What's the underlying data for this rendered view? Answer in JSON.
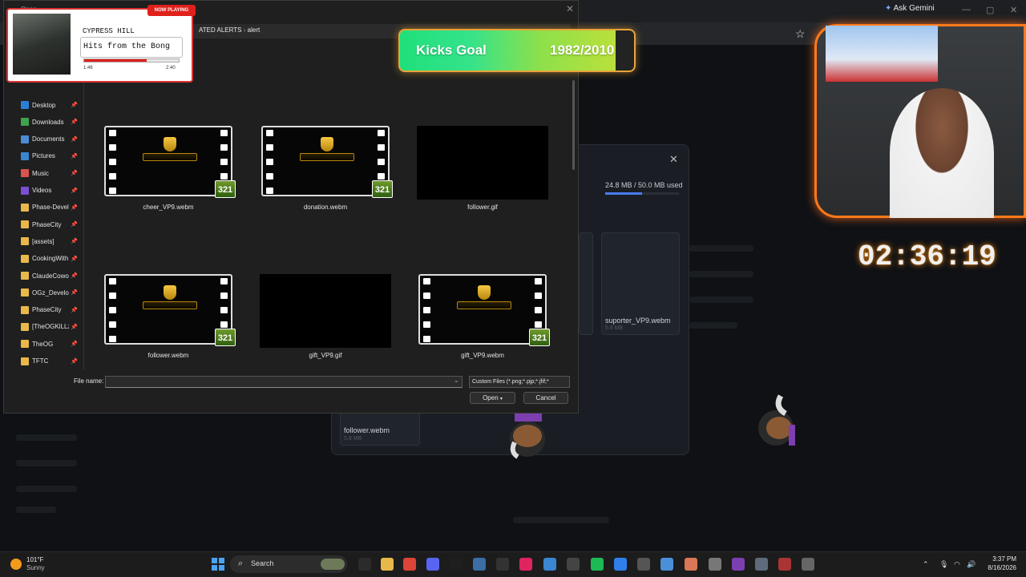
{
  "browser": {
    "ask_gemini": "Ask Gemini"
  },
  "dialog": {
    "title_partial": "Open",
    "breadcrumb": [
      "ATED ALERTS",
      "alert"
    ],
    "nav_items": [
      {
        "label": "Desktop",
        "icon": "desktop-icon",
        "color": "#2b7fd4"
      },
      {
        "label": "Downloads",
        "icon": "download-icon",
        "color": "#3fa34d"
      },
      {
        "label": "Documents",
        "icon": "documents-icon",
        "color": "#4c8bd6"
      },
      {
        "label": "Pictures",
        "icon": "pictures-icon",
        "color": "#3a86d1"
      },
      {
        "label": "Music",
        "icon": "music-icon",
        "color": "#d9534f"
      },
      {
        "label": "Videos",
        "icon": "videos-icon",
        "color": "#7a4fd1"
      },
      {
        "label": "Phase-Develc",
        "icon": "folder-icon",
        "color": "#e8b84a"
      },
      {
        "label": "PhaseCity",
        "icon": "folder-icon",
        "color": "#e8b84a"
      },
      {
        "label": "[assets]",
        "icon": "folder-icon",
        "color": "#e8b84a"
      },
      {
        "label": "CookingWith",
        "icon": "folder-icon",
        "color": "#e8b84a"
      },
      {
        "label": "ClaudeCowo",
        "icon": "folder-icon",
        "color": "#e8b84a"
      },
      {
        "label": "OGz_Develop",
        "icon": "folder-icon",
        "color": "#e8b84a"
      },
      {
        "label": "PhaseCity",
        "icon": "folder-icon",
        "color": "#e8b84a"
      },
      {
        "label": "[TheOGKiLLz",
        "icon": "folder-icon",
        "color": "#e8b84a"
      },
      {
        "label": "TheOG",
        "icon": "folder-icon",
        "color": "#e8b84a"
      },
      {
        "label": "TFTC",
        "icon": "folder-icon",
        "color": "#e8b84a"
      }
    ],
    "files": [
      {
        "name": "cheer_VP9.webm",
        "type": "video"
      },
      {
        "name": "donation.webm",
        "type": "video"
      },
      {
        "name": "follower.gif",
        "type": "blank"
      },
      {
        "name": "follower.webm",
        "type": "video"
      },
      {
        "name": "gift_VP9.gif",
        "type": "blank"
      },
      {
        "name": "gift_VP9.webm",
        "type": "video"
      }
    ],
    "badge_text": "321",
    "file_name_label": "File name:",
    "file_name_value": "",
    "filter_value": "Custom Files (*.png;*.pjp;*.jfif;*",
    "open_label": "Open",
    "cancel_label": "Cancel"
  },
  "modal": {
    "storage": "24.8 MB / 50.0 MB used",
    "storage_fraction": 0.496,
    "tiles": [
      {
        "name": "suporter_VP9.webm",
        "size": "5.6 MB"
      },
      {
        "name": "follower.webm",
        "size": "5.8 MB"
      }
    ]
  },
  "now_playing": {
    "badge": "NOW PLAYING",
    "artist": "CYPRESS HILL",
    "song": "Hits from the Bong",
    "elapsed": "1:46",
    "duration": "2:40",
    "progress": 0.66
  },
  "kicks_goal": {
    "label": "Kicks Goal",
    "value": "1982/2010",
    "progress": 0.986
  },
  "stream": {
    "timer": "02:36:19"
  },
  "taskbar": {
    "weather_temp": "101°F",
    "weather_desc": "Sunny",
    "search_label": "Search",
    "time": "3:37 PM",
    "date": "8/16/2026"
  }
}
